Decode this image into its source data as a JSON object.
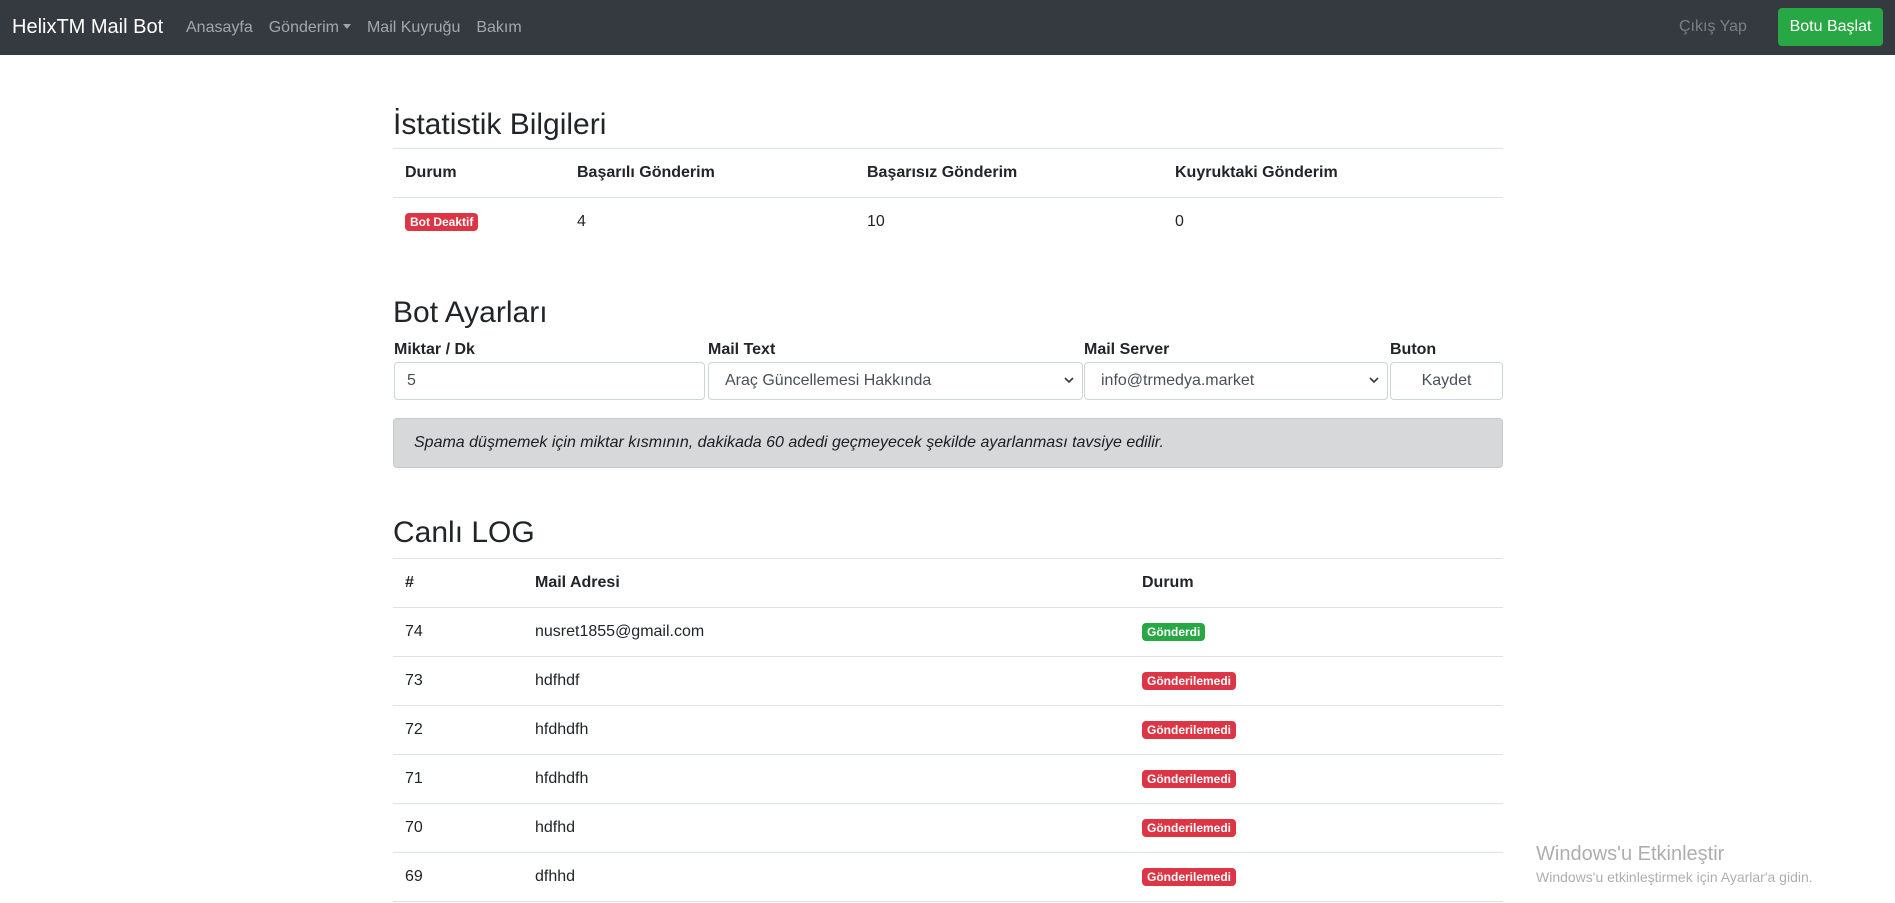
{
  "navbar": {
    "brand": "HelixTM Mail Bot",
    "links": [
      "Anasayfa",
      "Gönderim",
      "Mail Kuyruğu",
      "Bakım"
    ],
    "logout_label": "Çıkış Yap",
    "start_button_label": "Botu Başlat"
  },
  "stats": {
    "title": "İstatistik Bilgileri",
    "headers": [
      "Durum",
      "Başarılı Gönderim",
      "Başarısız Gönderim",
      "Kuyruktaki Gönderim"
    ],
    "status_badge": "Bot Deaktif",
    "successful": "4",
    "failed": "10",
    "queued": "0"
  },
  "bot_settings": {
    "title": "Bot Ayarları",
    "amount_label": "Miktar / Dk",
    "amount_value": "5",
    "mail_text_label": "Mail Text",
    "mail_text_value": "Araç Güncellemesi Hakkında",
    "mail_server_label": "Mail Server",
    "mail_server_value": "info@trmedya.market",
    "button_label": "Buton",
    "save_label": "Kaydet",
    "notice": "Spama düşmemek için miktar kısmının, dakikada 60 adedi geçmeyecek şekilde ayarlanması tavsiye edilir."
  },
  "live_log": {
    "title": "Canlı LOG",
    "headers": [
      "#",
      "Mail Adresi",
      "Durum"
    ],
    "rows": [
      {
        "id": "74",
        "email": "nusret1855@gmail.com",
        "status": "Gönderdi",
        "status_type": "success"
      },
      {
        "id": "73",
        "email": "hdfhdf",
        "status": "Gönderilemedi",
        "status_type": "danger"
      },
      {
        "id": "72",
        "email": "hfdhdfh",
        "status": "Gönderilemedi",
        "status_type": "danger"
      },
      {
        "id": "71",
        "email": "hfdhdfh",
        "status": "Gönderilemedi",
        "status_type": "danger"
      },
      {
        "id": "70",
        "email": "hdfhd",
        "status": "Gönderilemedi",
        "status_type": "danger"
      },
      {
        "id": "69",
        "email": "dfhhd",
        "status": "Gönderilemedi",
        "status_type": "danger"
      }
    ]
  },
  "watermark": {
    "title": "Windows'u Etkinleştir",
    "subtitle": "Windows'u etkinleştirmek için Ayarlar'a gidin."
  },
  "colors": {
    "navbar_bg": "#343a40",
    "success": "#28a745",
    "danger": "#dc3545",
    "alert_bg": "#d6d8d9"
  },
  "icons": {
    "dropdown_caret": "caret-down-icon",
    "select_arrow": "chevron-down-icon"
  }
}
